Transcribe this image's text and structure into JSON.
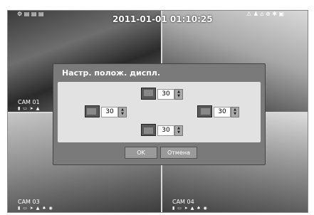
{
  "datetime": "2011-01-01 01:10:25",
  "cameras": [
    {
      "label": "CAM 01",
      "icons": "▮ ▭ ➤ ▲"
    },
    {
      "label": "CAM 03",
      "icons": "▮ ▭ ➤ ▲ ♠ ◉"
    },
    {
      "label": "CAM 04",
      "icons": "▮ ▭ ➤ ▲ ♠ ◉"
    }
  ],
  "status_icons_left": "⚙ ▤ ▤ ▤",
  "status_icons_right": "⚠ ♟ ⌂ ⊕ ✱ ▣",
  "dialog": {
    "title": "Настр. полож. диспл.",
    "top_value": "30",
    "left_value": "30",
    "right_value": "30",
    "bottom_value": "30",
    "ok_label": "OK",
    "cancel_label": "Отмена"
  }
}
